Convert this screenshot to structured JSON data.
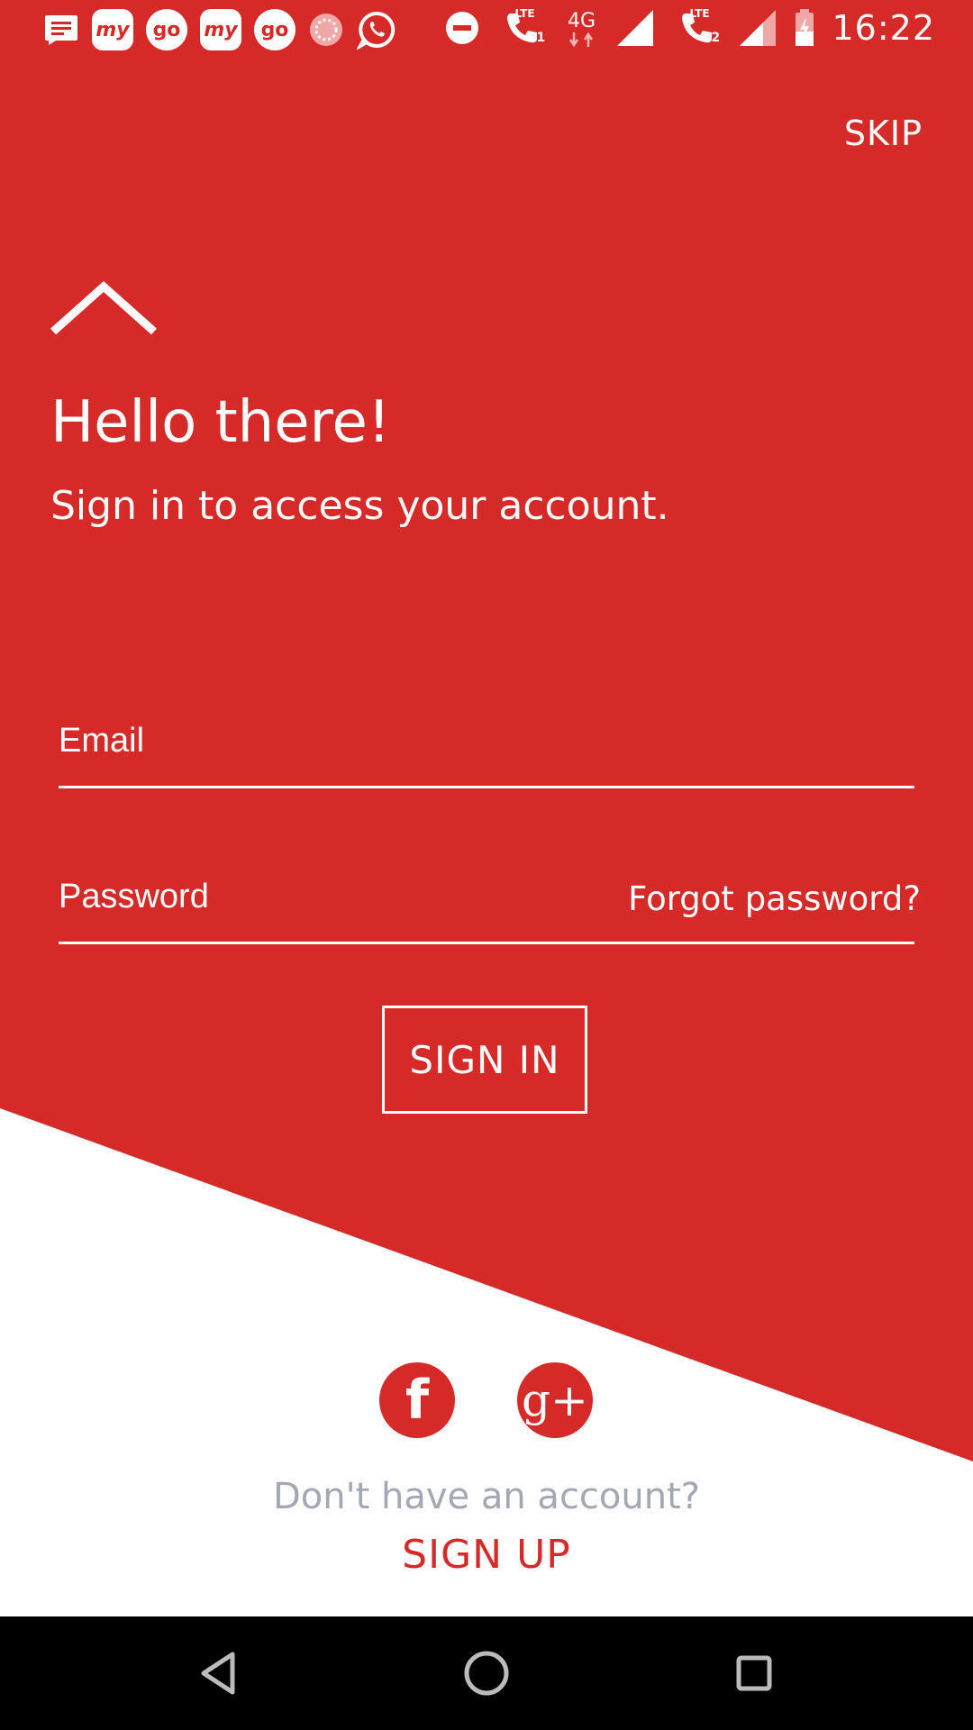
{
  "colors": {
    "brand_red": "#d62a28",
    "muted_gray": "#a3a8b3",
    "white": "#ffffff",
    "nav_black": "#000000"
  },
  "status_bar": {
    "time": "16:22",
    "left_icons": [
      "message-icon",
      "my-app-icon",
      "go-app-icon",
      "my-app-icon",
      "go-app-icon",
      "circle-app-icon",
      "whatsapp-icon"
    ],
    "right_icons": [
      "do-not-disturb-icon",
      "lte-call-1-icon",
      "4g-data-icon",
      "signal-icon",
      "lte-call-2-icon",
      "signal-weak-icon",
      "battery-charging-icon"
    ],
    "app_my": "my",
    "app_go": "go",
    "lte": "LTE",
    "net": "4G",
    "sim1": "1",
    "sim2": "2"
  },
  "header": {
    "skip_label": "SKIP"
  },
  "main": {
    "title": "Hello there!",
    "subtitle": "Sign in to access your account."
  },
  "form": {
    "email_placeholder": "Email",
    "email_value": "",
    "password_placeholder": "Password",
    "password_value": "",
    "forgot_label": "Forgot password?",
    "signin_label": "SIGN IN"
  },
  "social": {
    "facebook_glyph": "f",
    "google_glyph": "g+"
  },
  "footer": {
    "no_account_text": "Don't have an account?",
    "signup_label": "SIGN UP"
  },
  "nav": [
    "back-icon",
    "home-icon",
    "recents-icon"
  ]
}
